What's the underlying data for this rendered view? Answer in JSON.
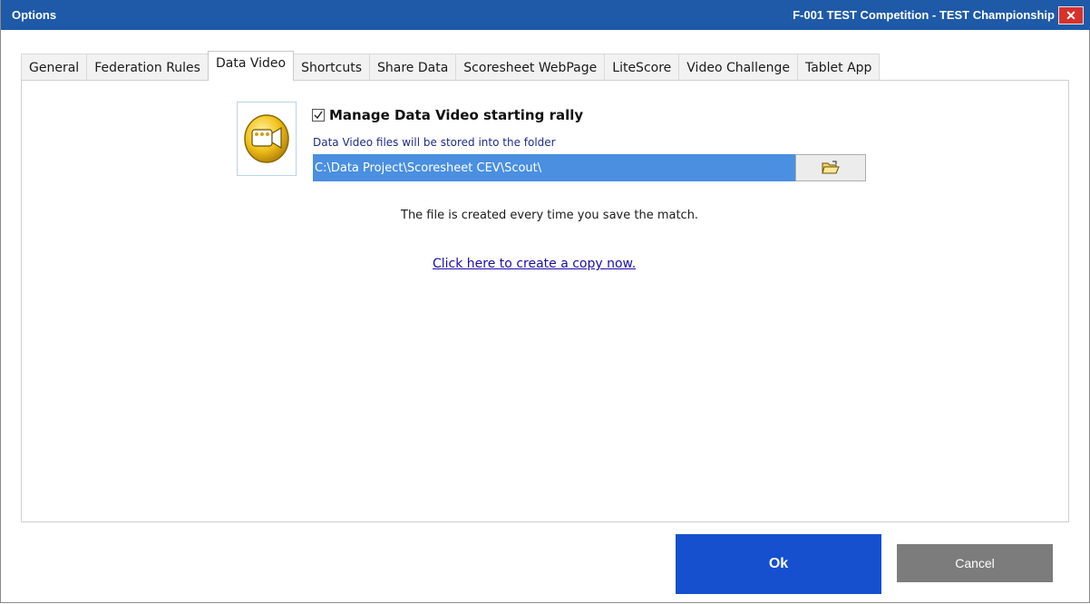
{
  "window": {
    "title": "Options",
    "context": "F-001  TEST Competition - TEST Championship",
    "close_glyph": "✕"
  },
  "tabs": [
    {
      "label": "General"
    },
    {
      "label": "Federation Rules"
    },
    {
      "label": "Data Video",
      "active": true
    },
    {
      "label": "Shortcuts"
    },
    {
      "label": "Share Data"
    },
    {
      "label": "Scoresheet WebPage"
    },
    {
      "label": "LiteScore"
    },
    {
      "label": "Video Challenge"
    },
    {
      "label": "Tablet App"
    }
  ],
  "data_video": {
    "icon": "video-camera-icon",
    "manage_checked": true,
    "manage_label": "Manage Data Video starting rally",
    "folder_hint": "Data Video files will be stored into the folder",
    "folder_path": "C:\\Data Project\\Scoresheet CEV\\Scout\\",
    "browse_icon": "open-folder-icon",
    "info": "The file is created every time you save the match.",
    "copy_link": "Click here to create a copy now."
  },
  "buttons": {
    "ok": "Ok",
    "cancel": "Cancel"
  },
  "colors": {
    "titlebar": "#1e5aa8",
    "close": "#d7312c",
    "path_highlight": "#4a8fe0",
    "ok": "#1650cf",
    "cancel": "#7c7c7c",
    "link": "#1a0dab"
  }
}
